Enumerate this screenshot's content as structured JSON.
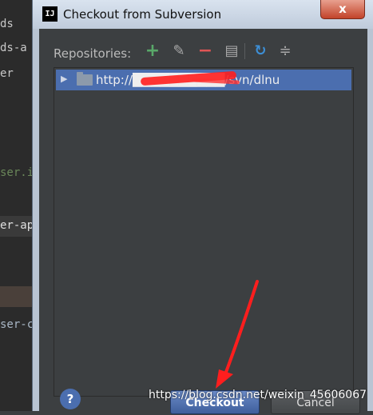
{
  "background_editor": {
    "lines": [
      "ds",
      "ds-a",
      "er",
      "ser.i",
      "er-ap",
      "ser-c"
    ]
  },
  "dialog": {
    "app_icon_text": "IJ",
    "title": "Checkout from Subversion",
    "close_label": "x"
  },
  "toolbar": {
    "repositories_label": "Repositories:",
    "icons": [
      "add-icon",
      "edit-icon",
      "remove-icon",
      "info-icon",
      "refresh-icon",
      "collapse-icon"
    ]
  },
  "repositories": [
    {
      "url": "http://██████████/svn/dlnu",
      "expanded": false,
      "selected": true
    }
  ],
  "buttons": {
    "help_label": "?",
    "checkout_label": "Checkout",
    "cancel_label": "Cancel"
  },
  "watermark": "https://blog.csdn.net/weixin_45606067",
  "colors": {
    "selection": "#4b6eaf",
    "annotation": "#ff1e1e"
  }
}
